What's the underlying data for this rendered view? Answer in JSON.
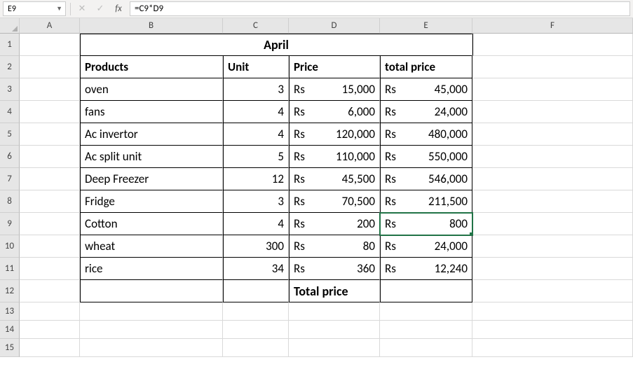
{
  "namebox": "E9",
  "formula": "=C9*D9",
  "columns": [
    "A",
    "B",
    "C",
    "D",
    "E",
    "F"
  ],
  "rows": [
    "1",
    "2",
    "3",
    "4",
    "5",
    "6",
    "7",
    "8",
    "9",
    "10",
    "11",
    "12",
    "13",
    "14",
    "15"
  ],
  "title": "April",
  "headers": {
    "products": "Products",
    "unit": "Unit",
    "price": "Price",
    "total": "total price"
  },
  "currency": "Rs",
  "items": {
    "0": {
      "name": "oven",
      "unit": "3",
      "price": "15,000",
      "total": "45,000"
    },
    "1": {
      "name": "fans",
      "unit": "4",
      "price": "6,000",
      "total": "24,000"
    },
    "2": {
      "name": "Ac invertor",
      "unit": "4",
      "price": "120,000",
      "total": "480,000"
    },
    "3": {
      "name": "Ac split unit",
      "unit": "5",
      "price": "110,000",
      "total": "550,000"
    },
    "4": {
      "name": "Deep Freezer",
      "unit": "12",
      "price": "45,500",
      "total": "546,000"
    },
    "5": {
      "name": "Fridge",
      "unit": "3",
      "price": "70,500",
      "total": "211,500"
    },
    "6": {
      "name": "Cotton",
      "unit": "4",
      "price": "200",
      "total": "800"
    },
    "7": {
      "name": "wheat",
      "unit": "300",
      "price": "80",
      "total": "24,000"
    },
    "8": {
      "name": "rice",
      "unit": "34",
      "price": "360",
      "total": "12,240"
    }
  },
  "footer": "Total price",
  "chart_data": {
    "type": "table",
    "title": "April",
    "columns": [
      "Products",
      "Unit",
      "Price",
      "total price"
    ],
    "rows": [
      [
        "oven",
        3,
        15000,
        45000
      ],
      [
        "fans",
        4,
        6000,
        24000
      ],
      [
        "Ac invertor",
        4,
        120000,
        480000
      ],
      [
        "Ac split unit",
        5,
        110000,
        550000
      ],
      [
        "Deep Freezer",
        12,
        45500,
        546000
      ],
      [
        "Fridge",
        3,
        70500,
        211500
      ],
      [
        "Cotton",
        4,
        200,
        800
      ],
      [
        "wheat",
        300,
        80,
        24000
      ],
      [
        "rice",
        34,
        360,
        12240
      ]
    ],
    "currency": "Rs"
  }
}
